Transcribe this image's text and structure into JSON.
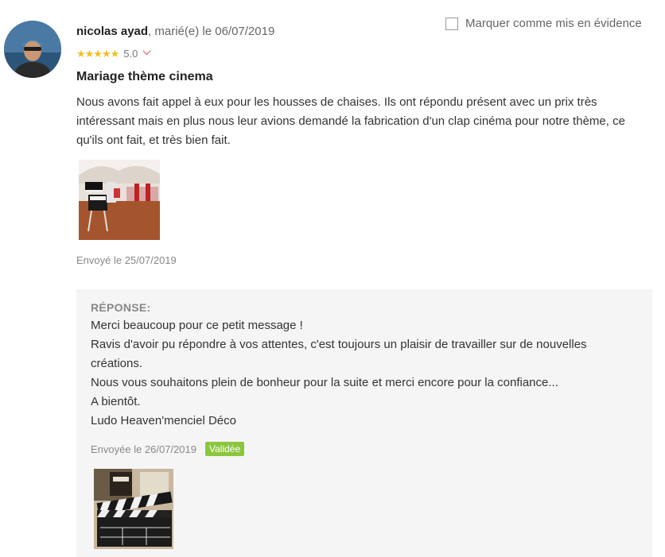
{
  "review": {
    "author": "nicolas ayad",
    "author_suffix": ", marié(e) le 06/07/2019",
    "rating_value": "5.0",
    "rating_stars": 5,
    "highlight_label": "Marquer comme mis en évidence",
    "title": "Mariage thème cinema",
    "text": "Nous avons fait appel à eux pour les housses de chaises. Ils ont répondu présent avec un prix très intéressant mais en plus nous leur avions demandé la fabrication d'un clap cinéma pour notre thème, ce qu'ils ont fait, et très bien fait.",
    "sent_date": "Envoyé le 25/07/2019"
  },
  "reply": {
    "heading": "RÉPONSE:",
    "lines": [
      "Merci beaucoup pour ce petit message !",
      "Ravis d'avoir pu répondre à vos attentes, c'est toujours un plaisir de travailler sur de nouvelles",
      "créations.",
      "Nous vous souhaitons plein de bonheur pour la suite et merci encore pour la confiance...",
      "A bientôt.",
      "Ludo Heaven'menciel Déco"
    ],
    "sent_date": "Envoyée le 26/07/2019",
    "status_badge": "Validée",
    "status_color": "#8cc63f"
  },
  "colors": {
    "star": "#f2c01f",
    "reply_background": "#f5f5f5"
  },
  "icons": {
    "rating": "star-icon",
    "expand": "chevron-down-icon",
    "highlight": "checkbox-icon"
  }
}
